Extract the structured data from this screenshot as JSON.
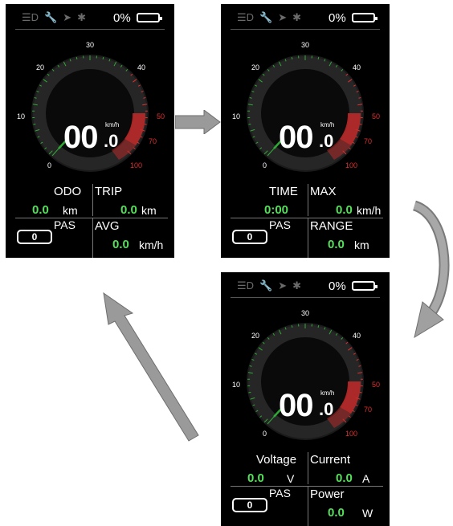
{
  "status": {
    "battery_percent": "0%",
    "icons": [
      "headlight-icon",
      "wrench-icon",
      "navigation-icon",
      "bluetooth-icon",
      "battery-icon"
    ]
  },
  "gauge": {
    "ticks": [
      "0",
      "10",
      "20",
      "30",
      "40",
      "50",
      "70",
      "100"
    ],
    "speed_int": "00",
    "speed_dec": ".0",
    "speed_unit": "km/h"
  },
  "screens": [
    {
      "left_label": "ODO",
      "right_label": "TRIP",
      "left_value": "0.0",
      "left_unit": "km",
      "right_value": "0.0",
      "right_unit": "km",
      "pas_label": "PAS",
      "pas_value": "0",
      "bottom_label": "AVG",
      "bottom_value": "0.0",
      "bottom_unit": "km/h"
    },
    {
      "left_label": "TIME",
      "right_label": "MAX",
      "left_value": "0:00",
      "left_unit": "",
      "right_value": "0.0",
      "right_unit": "km/h",
      "pas_label": "PAS",
      "pas_value": "0",
      "bottom_label": "RANGE",
      "bottom_value": "0.0",
      "bottom_unit": "km"
    },
    {
      "left_label": "Voltage",
      "right_label": "Current",
      "left_value": "0.0",
      "left_unit": "V",
      "right_value": "0.0",
      "right_unit": "A",
      "pas_label": "PAS",
      "pas_value": "0",
      "bottom_label": "Power",
      "bottom_value": "0.0",
      "bottom_unit": "W"
    }
  ],
  "colors": {
    "value_green": "#54e05a",
    "gauge_green": "#2faa35",
    "gauge_red": "#e03030",
    "arrow_gray": "#999999"
  }
}
